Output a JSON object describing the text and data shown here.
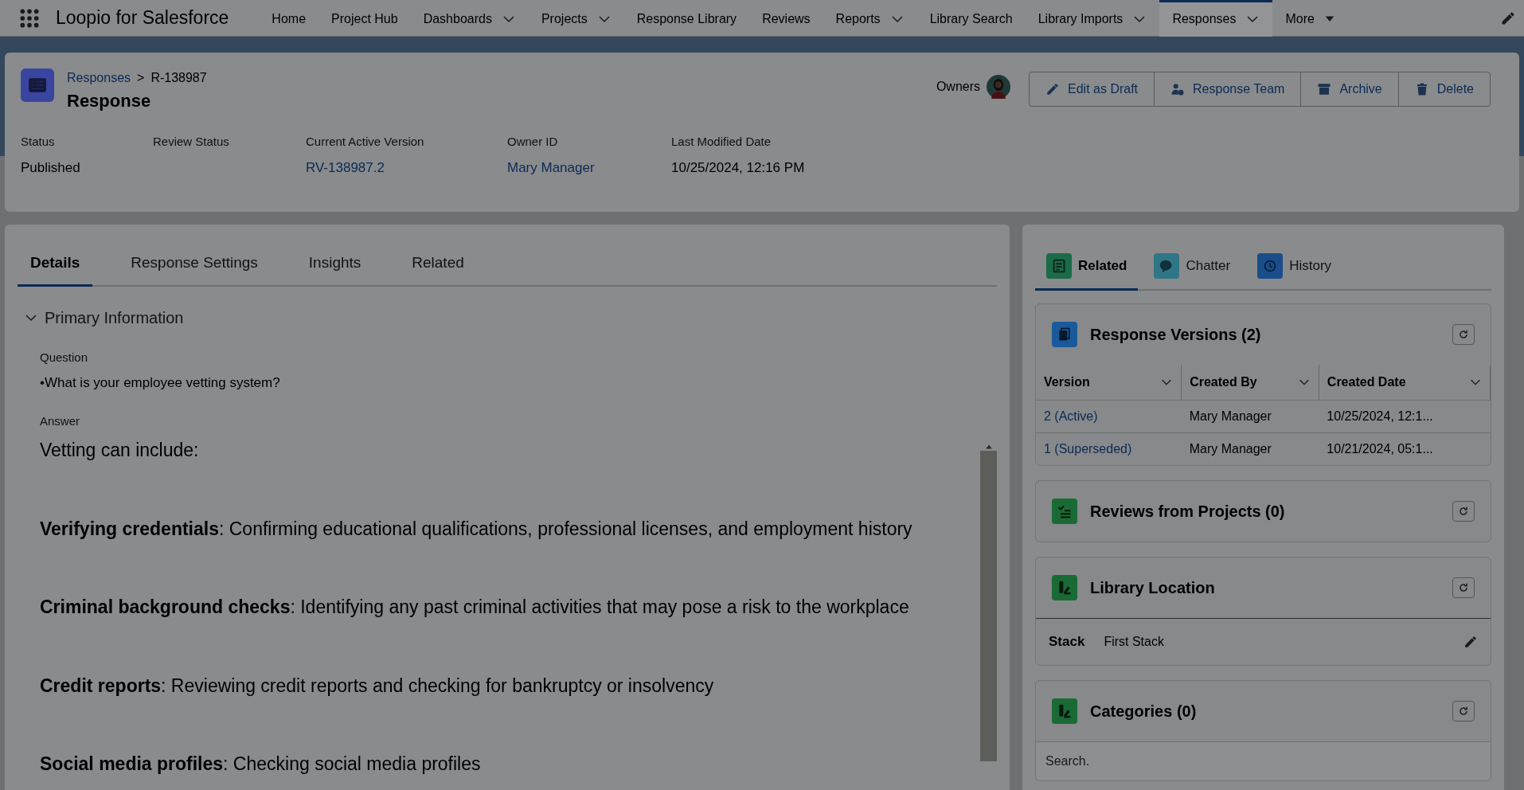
{
  "app": {
    "name": "Loopio for Salesforce"
  },
  "nav": [
    {
      "label": "Home",
      "kind": "plain",
      "selected": false
    },
    {
      "label": "Project Hub",
      "kind": "plain",
      "selected": false
    },
    {
      "label": "Dashboards",
      "kind": "chevron",
      "selected": false
    },
    {
      "label": "Projects",
      "kind": "chevron",
      "selected": false
    },
    {
      "label": "Response Library",
      "kind": "plain",
      "selected": false
    },
    {
      "label": "Reviews",
      "kind": "plain",
      "selected": false
    },
    {
      "label": "Reports",
      "kind": "chevron",
      "selected": false
    },
    {
      "label": "Library Search",
      "kind": "plain",
      "selected": false
    },
    {
      "label": "Library Imports",
      "kind": "chevron",
      "selected": false
    },
    {
      "label": "Responses",
      "kind": "chevron",
      "selected": true
    },
    {
      "label": "More",
      "kind": "triangle",
      "selected": false
    }
  ],
  "record": {
    "breadcrumb_link": "Responses",
    "breadcrumb_separator": ">",
    "breadcrumb_current": "R-138987",
    "title": "Response",
    "owners_label": "Owners",
    "actions": [
      {
        "label": "Edit as Draft",
        "kind": "pencil"
      },
      {
        "label": "Response Team",
        "kind": "person"
      },
      {
        "label": "Archive",
        "kind": "archive"
      },
      {
        "label": "Delete",
        "kind": "trash"
      }
    ],
    "fields": [
      {
        "label": "Status",
        "value": "Published",
        "kind": "text"
      },
      {
        "label": "Review Status"
      },
      {
        "label": "Current Active Version",
        "value": "RV-138987.2",
        "kind": "link"
      },
      {
        "label": "Owner ID",
        "value": "Mary Manager",
        "kind": "link"
      },
      {
        "label": "Last Modified Date",
        "value": "10/25/2024, 12:16 PM",
        "kind": "text"
      }
    ]
  },
  "details": {
    "tabs": [
      {
        "label": "Details",
        "selected": true
      },
      {
        "label": "Response Settings",
        "selected": false
      },
      {
        "label": "Insights",
        "selected": false
      },
      {
        "label": "Related",
        "selected": false
      }
    ],
    "section": {
      "title": "Primary Information",
      "expanded": true
    },
    "question": {
      "label": "Question",
      "value": "•What is your employee vetting system?"
    },
    "answer": {
      "label": "Answer",
      "intro": "Vetting can include:",
      "items": [
        "**Verifying credentials**: Confirming educational qualifications, professional licenses, and employment history",
        "**Criminal background checks**: Identifying any past criminal activities that may pose a risk to the workplace",
        "**Credit reports**: Reviewing credit reports and checking for bankruptcy or insolvency",
        "**Social media profiles**: Checking social media profiles"
      ]
    }
  },
  "side": {
    "tabs": [
      {
        "label": "Related",
        "selected": true,
        "color": "#1a6b48"
      },
      {
        "label": "Chatter",
        "selected": false,
        "color": "#2f7687"
      },
      {
        "label": "History",
        "selected": false,
        "color": "#1a4d8a"
      }
    ],
    "cards": [
      {
        "title": "Response Versions (2)",
        "kind": "table",
        "color": "#1a5a9c",
        "columns": [
          "Version",
          "Created By",
          "Created Date"
        ],
        "rows": [
          [
            "2 (Active)",
            "Mary Manager",
            "10/25/2024, 12:1..."
          ],
          [
            "1 (Superseded)",
            "Mary Manager",
            "10/21/2024, 05:1..."
          ]
        ]
      },
      {
        "title": "Reviews from Projects (0)",
        "kind": "empty",
        "color": "#1a6a35"
      },
      {
        "title": "Library Location",
        "kind": "field",
        "color": "#1a6a35",
        "field_label": "Stack",
        "field_value": "First Stack"
      },
      {
        "title": "Categories (0)",
        "kind": "search",
        "color": "#1a6a35",
        "placeholder": "Search."
      }
    ]
  }
}
